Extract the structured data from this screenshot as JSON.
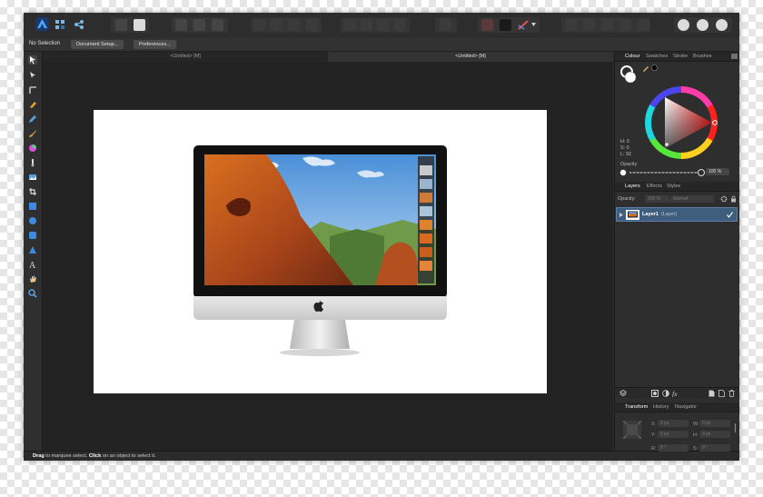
{
  "context_toolbar": {
    "selection": "No Selection",
    "document_setup": "Document Setup...",
    "preferences": "Preferences..."
  },
  "tabs": [
    "<Untitled> [M]",
    "<Untitled> [M]"
  ],
  "status": {
    "drag": "Drag",
    "drag_text": " to marquee select. ",
    "click": "Click",
    "click_text": " on an object to select it."
  },
  "colour_panel": {
    "tabs": [
      "Colour",
      "Swatches",
      "Stroke",
      "Brushes"
    ],
    "h": "H: 0",
    "s": "S: 0",
    "l": "L: 92",
    "opacity_label": "Opacity",
    "opacity_value": "100 %",
    "opacity_fraction": 1.0
  },
  "layers_panel": {
    "tabs": [
      "Layers",
      "Effects",
      "Styles"
    ],
    "opacity_label": "Opacity:",
    "opacity_value": "100 %",
    "blend_mode": "Normal",
    "layer_name": "Layer1",
    "layer_type": "(Layer)"
  },
  "transform_panel": {
    "tabs": [
      "Transform",
      "History",
      "Navigator"
    ],
    "x_label": "X:",
    "x_value": "0 px",
    "y_label": "Y:",
    "y_value": "0 px",
    "w_label": "W:",
    "w_value": "0 px",
    "h_label": "H:",
    "h_value": "0 px",
    "r_label": "R:",
    "r_value": "0 °",
    "s_label": "S:",
    "s_value": "0 °"
  },
  "colors": {
    "accent": "#1d8fe8",
    "layer_selected": "#3f5d7d"
  }
}
